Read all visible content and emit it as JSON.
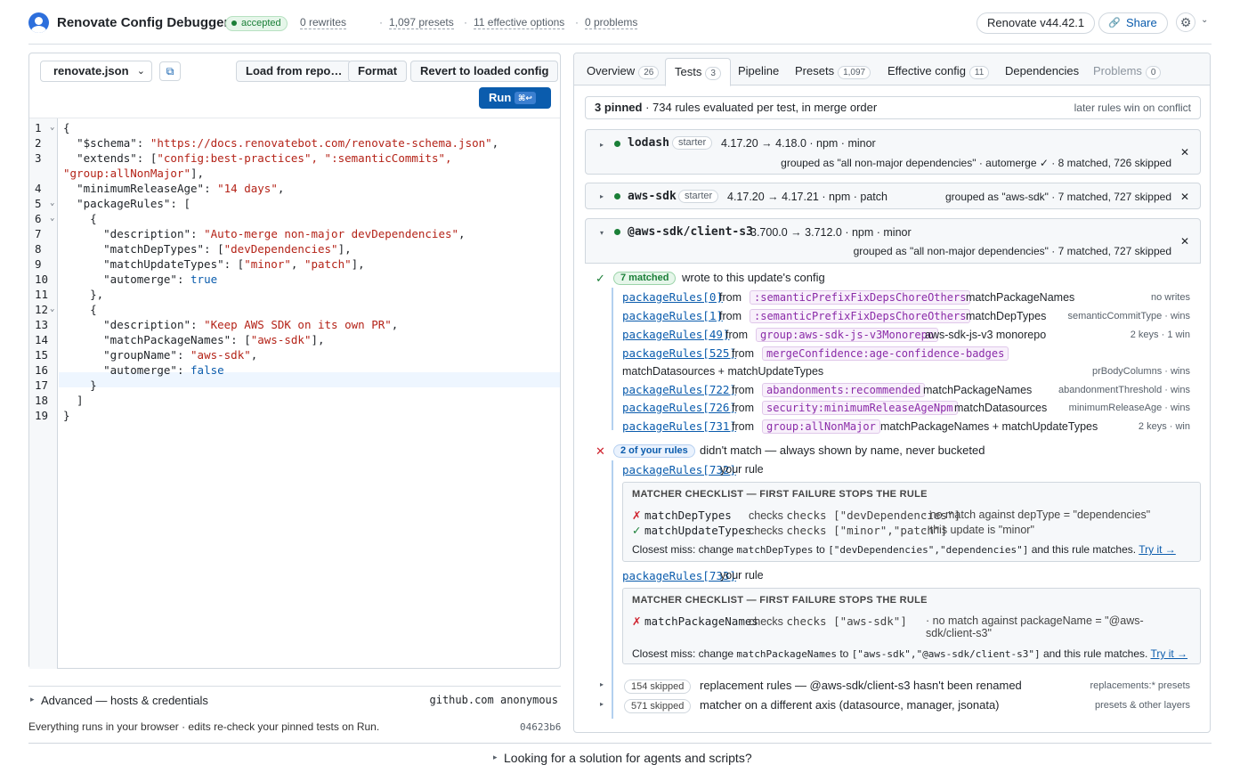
{
  "header": {
    "title": "Renovate Config Debugger",
    "status": "accepted",
    "stats": [
      "0 rewrites",
      "1,097 presets",
      "11 effective options",
      "0 problems"
    ],
    "version_label": "Renovate v44.42.1",
    "share_label": "Share"
  },
  "editor": {
    "file_selected": "renovate.json",
    "buttons": {
      "load": "Load from repo…",
      "format": "Format",
      "revert": "Revert to loaded config",
      "run": "Run",
      "run_kbd": "⌘↩"
    },
    "line_numbers": [
      "1",
      "2",
      "3",
      "",
      "4",
      "5",
      "6",
      "7",
      "8",
      "9",
      "10",
      "11",
      "12",
      "13",
      "14",
      "15",
      "16",
      "17",
      "18",
      "19"
    ],
    "lines": [
      "{",
      "  \"$schema\": \"https://docs.renovatebot.com/renovate-schema.json\",",
      "  \"extends\": [\"config:best-practices\", \":semanticCommits\",",
      "\"group:allNonMajor\"],",
      "  \"minimumReleaseAge\": \"14 days\",",
      "  \"packageRules\": [",
      "    {",
      "      \"description\": \"Auto-merge non-major devDependencies\",",
      "      \"matchDepTypes\": [\"devDependencies\"],",
      "      \"matchUpdateTypes\": [\"minor\", \"patch\"],",
      "      \"automerge\": true",
      "    },",
      "    {",
      "      \"description\": \"Keep AWS SDK on its own PR\",",
      "      \"matchPackageNames\": [\"aws-sdk\"],",
      "      \"groupName\": \"aws-sdk\",",
      "      \"automerge\": false",
      "    }",
      "  ]",
      "}"
    ]
  },
  "advanced": {
    "label": "Advanced — hosts & credentials",
    "value": "github.com anonymous"
  },
  "footer": {
    "note": "Everything runs in your browser · edits re-check your pinned tests on Run.",
    "commit": "04623b6"
  },
  "tabs": [
    {
      "label": "Overview",
      "count": "26"
    },
    {
      "label": "Tests",
      "count": "3"
    },
    {
      "label": "Pipeline",
      "count": ""
    },
    {
      "label": "Presets",
      "count": "1,097"
    },
    {
      "label": "Effective config",
      "count": "11"
    },
    {
      "label": "Dependencies",
      "count": ""
    },
    {
      "label": "Problems",
      "count": "0"
    }
  ],
  "summary": {
    "pinned": "3 pinned",
    "rest": "· 734 rules evaluated per test, in merge order",
    "right": "later rules win on conflict"
  },
  "tests": [
    {
      "name": "lodash",
      "tag": "starter",
      "version": "4.17.20 → 4.18.0 · npm · minor",
      "result": "grouped as \"all non-major dependencies\" · automerge ✓ · 8 matched, 726 skipped"
    },
    {
      "name": "aws-sdk",
      "tag": "starter",
      "version": "4.17.20 → 4.17.21 · npm · patch",
      "result": "grouped as \"aws-sdk\" · 7 matched, 727 skipped"
    },
    {
      "name": "@aws-sdk/client-s3",
      "tag": "",
      "version": "3.700.0 → 3.712.0 · npm · minor",
      "result": "grouped as \"all non-major dependencies\" · 7 matched, 727 skipped"
    }
  ],
  "detail": {
    "matched_badge": "7 matched",
    "matched_text": "wrote to this update's config",
    "matched_rules": [
      {
        "ref": "packageRules[0]",
        "from": "from",
        "preset": ":semanticPrefixFixDepsChoreOthers",
        "matcher": "matchPackageNames",
        "note": "no writes"
      },
      {
        "ref": "packageRules[1]",
        "from": "from",
        "preset": ":semanticPrefixFixDepsChoreOthers",
        "matcher": "matchDepTypes",
        "note": "semanticCommitType · wins"
      },
      {
        "ref": "packageRules[49]",
        "from": "from",
        "preset": "group:aws-sdk-js-v3Monorepo",
        "matcher": "aws-sdk-js-v3 monorepo",
        "note": "2 keys · 1 win"
      },
      {
        "ref": "packageRules[525]",
        "from": "from",
        "preset": "mergeConfidence:age-confidence-badges",
        "matcher": "",
        "note": ""
      },
      {
        "ref": "packageRules[722]",
        "from": "from",
        "preset": "abandonments:recommended",
        "matcher": "matchPackageNames",
        "note": "abandonmentThreshold · wins"
      },
      {
        "ref": "packageRules[726]",
        "from": "from",
        "preset": "security:minimumReleaseAgeNpm",
        "matcher": "matchDatasources",
        "note": "minimumReleaseAge · wins"
      },
      {
        "ref": "packageRules[731]",
        "from": "from",
        "preset": "group:allNonMajor",
        "matcher": "matchPackageNames + matchUpdateTypes",
        "note": "2 keys · win"
      }
    ],
    "wrap_line": {
      "text": "matchDatasources + matchUpdateTypes",
      "note": "prBodyColumns · wins"
    },
    "unmatched_badge": "2 of your rules",
    "unmatched_text": "didn't match — always shown by name, never bucketed",
    "your_rules": [
      {
        "ref": "packageRules[732]",
        "tag": "your rule",
        "heading": "MATCHER CHECKLIST — FIRST FAILURE STOPS THE RULE",
        "checks": [
          {
            "mark": "✗",
            "name": "matchDepTypes",
            "checks": "checks [\"devDependencies\"]",
            "comment": "· no match against depType = \"dependencies\""
          },
          {
            "mark": "✓",
            "name": "matchUpdateTypes",
            "checks": "checks [\"minor\",\"patch\"]",
            "comment": "· this update is \"minor\""
          }
        ],
        "closest_a": "Closest miss: change",
        "closest_key": "matchDepTypes",
        "closest_b": "to",
        "closest_val": "[\"devDependencies\",\"dependencies\"]",
        "closest_c": "and this rule matches.",
        "try": "Try it →"
      },
      {
        "ref": "packageRules[733]",
        "tag": "your rule",
        "heading": "MATCHER CHECKLIST — FIRST FAILURE STOPS THE RULE",
        "checks": [
          {
            "mark": "✗",
            "name": "matchPackageNames",
            "checks": "checks [\"aws-sdk\"]",
            "comment": "· no match against packageName = \"@aws-",
            "comment2": "sdk/client-s3\""
          }
        ],
        "closest_a": "Closest miss: change",
        "closest_key": "matchPackageNames",
        "closest_b": "to",
        "closest_val": "[\"aws-sdk\",\"@aws-sdk/client-s3\"]",
        "closest_c": "and this rule matches.",
        "try": "Try it →"
      }
    ],
    "skipped": [
      {
        "badge": "154 skipped",
        "text": "replacement rules — @aws-sdk/client-s3 hasn't been renamed",
        "note": "replacements:* presets"
      },
      {
        "badge": "571 skipped",
        "text": "matcher on a different axis (datasource, manager, jsonata)",
        "note": "presets & other layers"
      }
    ]
  },
  "bottom": {
    "label": "Looking for a solution for agents and scripts?"
  }
}
